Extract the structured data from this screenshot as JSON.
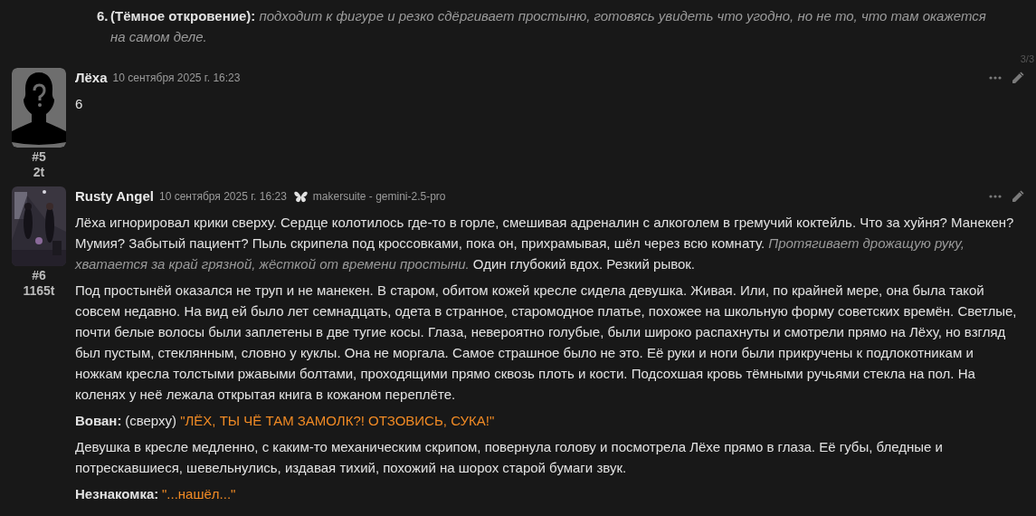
{
  "top_item": {
    "number": "6.",
    "title": "(Тёмное откровение):",
    "text": "подходит к фигуре и резко сдёргивает простыню, готовясь увидеть что угодно, но не то, что там окажется на самом деле."
  },
  "page_indicator": "3/3",
  "messages": [
    {
      "author": "Лёха",
      "date": "10 сентября 2025 г. 16:23",
      "avatar": {
        "kind": "silhouette"
      },
      "number": "#5",
      "tokens": "2t",
      "paragraphs": [
        [
          {
            "kind": "text",
            "text": "6"
          }
        ]
      ]
    },
    {
      "author": "Rusty Angel",
      "date": "10 сентября 2025 г. 16:23",
      "model": "makersuite - gemini-2.5-pro",
      "avatar": {
        "kind": "picture"
      },
      "number": "#6",
      "tokens": "1165t",
      "paragraphs": [
        [
          {
            "kind": "text",
            "text": "Лёха игнорировал крики сверху. Сердце колотилось где-то в горле, смешивая адреналин с алкоголем в гремучий коктейль. Что за хуйня? Манекен? Мумия? Забытый пациент? Пыль скрипела под кроссовками, пока он, прихрамывая, шёл через всю комнату. "
          },
          {
            "kind": "action",
            "text": "Протягивает дрожащую руку, хватается за край грязной, жёсткой от времени простыни."
          },
          {
            "kind": "text",
            "text": " Один глубокий вдох. Резкий рывок."
          }
        ],
        [
          {
            "kind": "text",
            "text": "Под простынёй оказался не труп и не манекен. В старом, обитом кожей кресле сидела девушка. Живая. Или, по крайней мере, она была такой совсем недавно. На вид ей было лет семнадцать, одета в странное, старомодное платье, похожее на школьную форму советских времён. Светлые, почти белые волосы были заплетены в две тугие косы. Глаза, невероятно голубые, были широко распахнуты и смотрели прямо на Лёху, но взгляд был пустым, стеклянным, словно у куклы. Она не моргала. Самое страшное было не это. Её руки и ноги были прикручены к подлокотникам и ножкам кресла толстыми ржавыми болтами, проходящими прямо сквозь плоть и кости. Подсохшая кровь тёмными ручьями стекла на пол. На коленях у неё лежала открытая книга в кожаном переплёте."
          }
        ],
        [
          {
            "kind": "speaker",
            "text": "Вован:"
          },
          {
            "kind": "text",
            "text": "(сверху) "
          },
          {
            "kind": "speech",
            "text": "\"ЛЁХ, ТЫ ЧЁ ТАМ ЗАМОЛК?! ОТЗОВИСЬ, СУКА!\""
          }
        ],
        [
          {
            "kind": "text",
            "text": "Девушка в кресле медленно, с каким-то механическим скрипом, повернула голову и посмотрела Лёхе прямо в глаза. Её губы, бледные и потрескавшиеся, шевельнулись, издавая тихий, похожий на шорох старой бумаги звук."
          }
        ],
        [
          {
            "kind": "speaker",
            "text": "Незнакомка:"
          },
          {
            "kind": "speech",
            "text": "\"...нашёл...\""
          }
        ]
      ]
    }
  ]
}
